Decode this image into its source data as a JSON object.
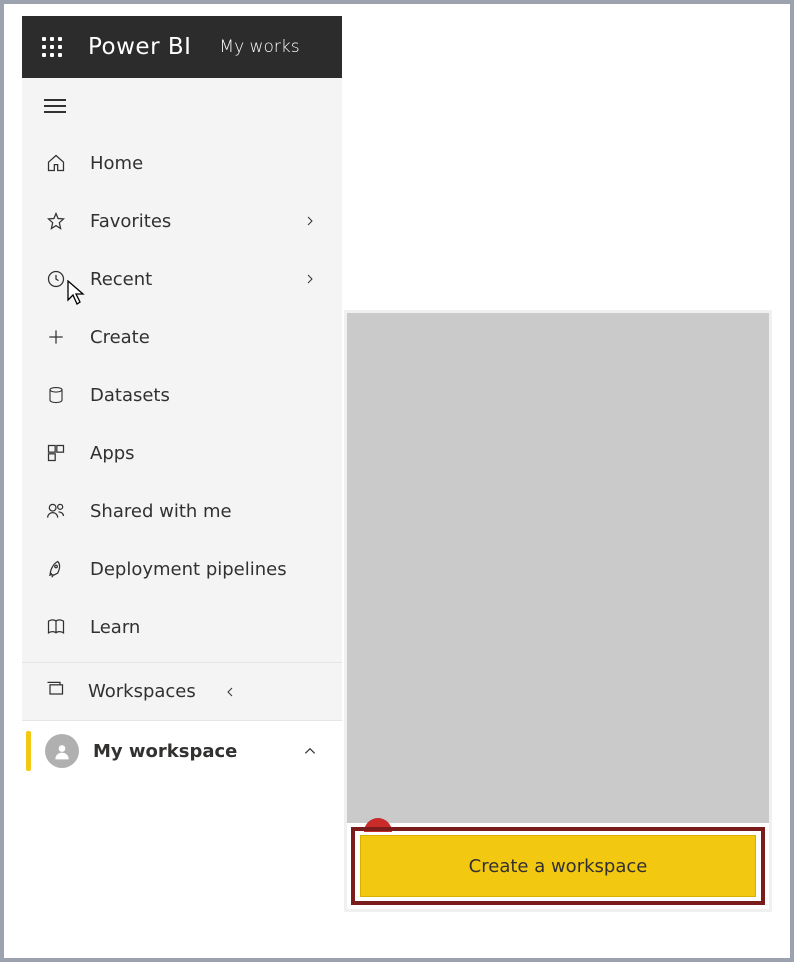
{
  "header": {
    "brand": "Power BI",
    "breadcrumb": "My works"
  },
  "sidebar": {
    "items": [
      {
        "label": "Home",
        "icon": "home-icon",
        "chevron": null
      },
      {
        "label": "Favorites",
        "icon": "star-icon",
        "chevron": "right"
      },
      {
        "label": "Recent",
        "icon": "clock-icon",
        "chevron": "right"
      },
      {
        "label": "Create",
        "icon": "plus-icon",
        "chevron": null
      },
      {
        "label": "Datasets",
        "icon": "database-icon",
        "chevron": null
      },
      {
        "label": "Apps",
        "icon": "apps-icon",
        "chevron": null
      },
      {
        "label": "Shared with me",
        "icon": "people-icon",
        "chevron": null
      },
      {
        "label": "Deployment pipelines",
        "icon": "rocket-icon",
        "chevron": null
      },
      {
        "label": "Learn",
        "icon": "book-icon",
        "chevron": null
      }
    ],
    "workspaces_label": "Workspaces",
    "my_workspace_label": "My workspace"
  },
  "flyout": {
    "create_button_label": "Create a workspace"
  },
  "colors": {
    "accent_yellow": "#f2c811",
    "header_bg": "#2c2c2c",
    "highlight_border": "#7a1c1c"
  }
}
